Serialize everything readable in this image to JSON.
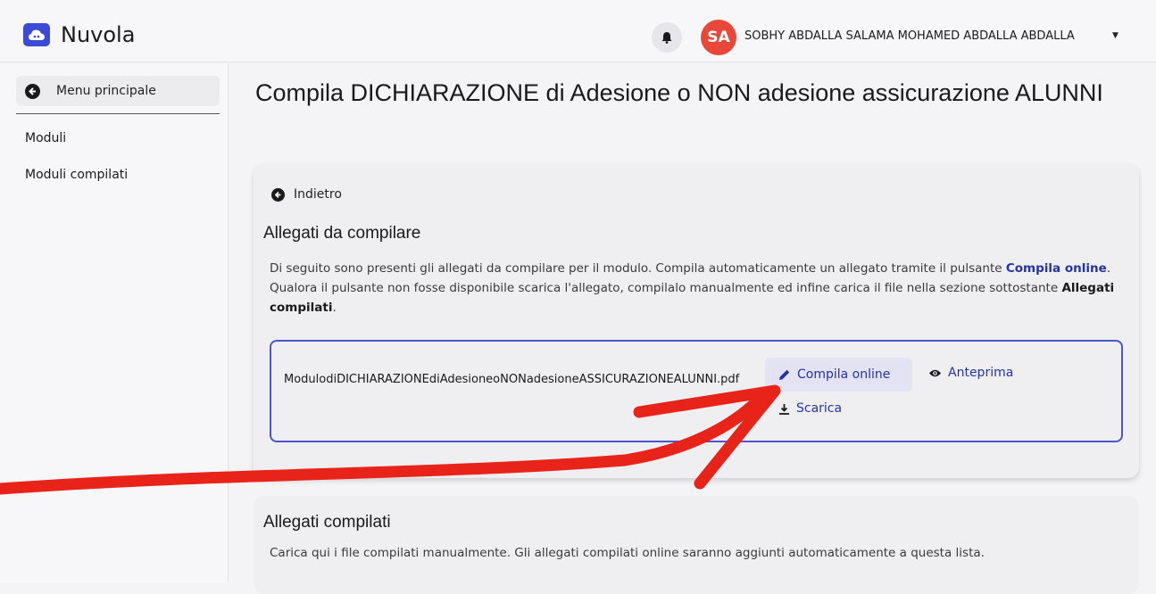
{
  "app": {
    "title": "Nuvola",
    "user": {
      "initials": "SA",
      "name": "SOBHY ABDALLA SALAMA MOHAMED ABDALLA ABDALLA",
      "avatar_color": "#e8483a"
    }
  },
  "sidebar": {
    "main_menu_label": "Menu principale",
    "items": [
      {
        "label": "Moduli"
      },
      {
        "label": "Moduli compilati"
      }
    ]
  },
  "page": {
    "title": "Compila DICHIARAZIONE di Adesione o NON adesione assicurazione ALUNNI"
  },
  "attachments_card": {
    "back_label": "Indietro",
    "title": "Allegati da compilare",
    "description": {
      "part1": "Di seguito sono presenti gli allegati da compilare per il modulo. Compila automaticamente un allegato tramite il pulsante ",
      "bold1": "Compila online",
      "part2": ". Qualora il pulsante non fosse disponibile scarica l'allegato, compilalo manualmente ed infine carica il file nella sezione sottostante ",
      "bold2": "Allegati compilati",
      "part3": "."
    },
    "file": {
      "name": "ModulodiDICHIARAZIONEdiAdesioneoNONadesioneASSICURAZIONEALUNNI.pdf",
      "compile_label": "Compila online",
      "preview_label": "Anteprima",
      "download_label": "Scarica"
    }
  },
  "compiled_card": {
    "title": "Allegati compilati",
    "description": "Carica qui i file compilati manualmente. Gli allegati compilati online saranno aggiunti automaticamente a questa lista."
  },
  "colors": {
    "accent": "#2532a8",
    "brand": "#3b4bd6",
    "annotation_arrow": "#e8231a"
  }
}
